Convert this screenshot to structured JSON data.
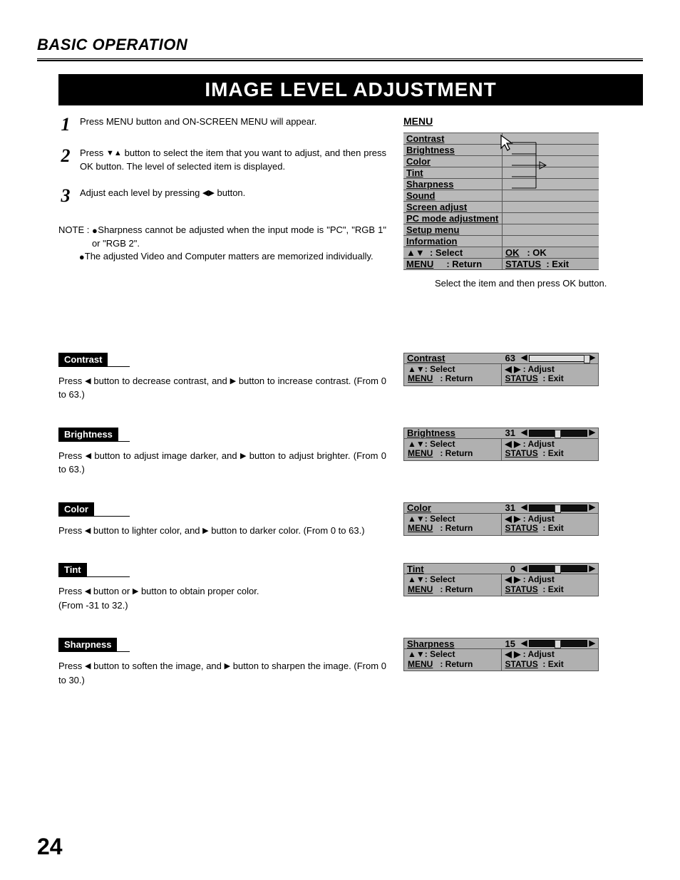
{
  "header": {
    "section": "BASIC OPERATION",
    "banner": "IMAGE LEVEL ADJUSTMENT"
  },
  "steps": [
    {
      "n": "1",
      "text": "Press MENU button and ON-SCREEN MENU will appear."
    },
    {
      "n": "2",
      "pre": "Press ",
      "post": " button to select the item that you want to adjust, and then press OK button. The level of selected item is displayed."
    },
    {
      "n": "3",
      "pre": "Adjust each level by pressing ",
      "post": " button."
    }
  ],
  "note": {
    "label": "NOTE : ",
    "a": "Sharpness cannot be adjusted when the input mode is \"PC\", \"RGB 1\" or \"RGB 2\".",
    "b": "The adjusted Video and Computer matters are memorized individually."
  },
  "menu": {
    "title": "MENU",
    "items": [
      "Contrast",
      "Brightness",
      "Color",
      "Tint",
      "Sharpness",
      "Sound",
      "Screen  adjust",
      "PC  mode  adjustment",
      "Setup  menu",
      "Information"
    ],
    "foot": {
      "l1a": "▲▼",
      "l1b": ": Select",
      "l2a": "MENU",
      "l2b": ": Return",
      "r1a": "OK",
      "r1b": ":  OK",
      "r2a": "STATUS",
      "r2b": ":  Exit"
    },
    "caption": "Select the item and then press OK button."
  },
  "adjustments": [
    {
      "key": "contrast",
      "label": "Contrast",
      "text_pre": "Press ",
      "text_mid": " button to decrease contrast, and ",
      "text_post": " button to increase contrast.  (From 0 to 63.)",
      "value": "63",
      "fill": 100,
      "knob": 100
    },
    {
      "key": "brightness",
      "label": "Brightness",
      "text_pre": "Press ",
      "text_mid": " button to adjust image darker, and ",
      "text_post": " button to adjust brighter.  (From 0 to 63.)",
      "value": "31",
      "fill": 0,
      "knob": 49
    },
    {
      "key": "color",
      "label": "Color",
      "text_pre": "Press ",
      "text_mid": " button to lighter color, and ",
      "text_post": " button to darker color. (From 0 to 63.)",
      "value": "31",
      "fill": 0,
      "knob": 49
    },
    {
      "key": "tint",
      "label": "Tint",
      "text_pre": "Press  ",
      "text_mid": " button or ",
      "text_post": " button to obtain proper color.\n (From -31 to 32.)",
      "value": "0",
      "fill": 0,
      "knob": 49
    },
    {
      "key": "sharpness",
      "label": "Sharpness",
      "text_pre": "Press ",
      "text_mid": " button to soften the image, and ",
      "text_post": " button to sharpen the image.  (From 0 to 30.)",
      "value": "15",
      "fill": 0,
      "knob": 49
    }
  ],
  "adjfoot": {
    "l1": "▲▼: Select",
    "l2": "MENU    : Return",
    "r1": "◀ ▶ : Adjust",
    "r2": "STATUS  : Exit"
  },
  "page": "24",
  "glyph": {
    "left": "◀",
    "right": "▶",
    "up": "▲",
    "down": "▼",
    "updown": "▼▲",
    "leftright": "◀▶"
  }
}
